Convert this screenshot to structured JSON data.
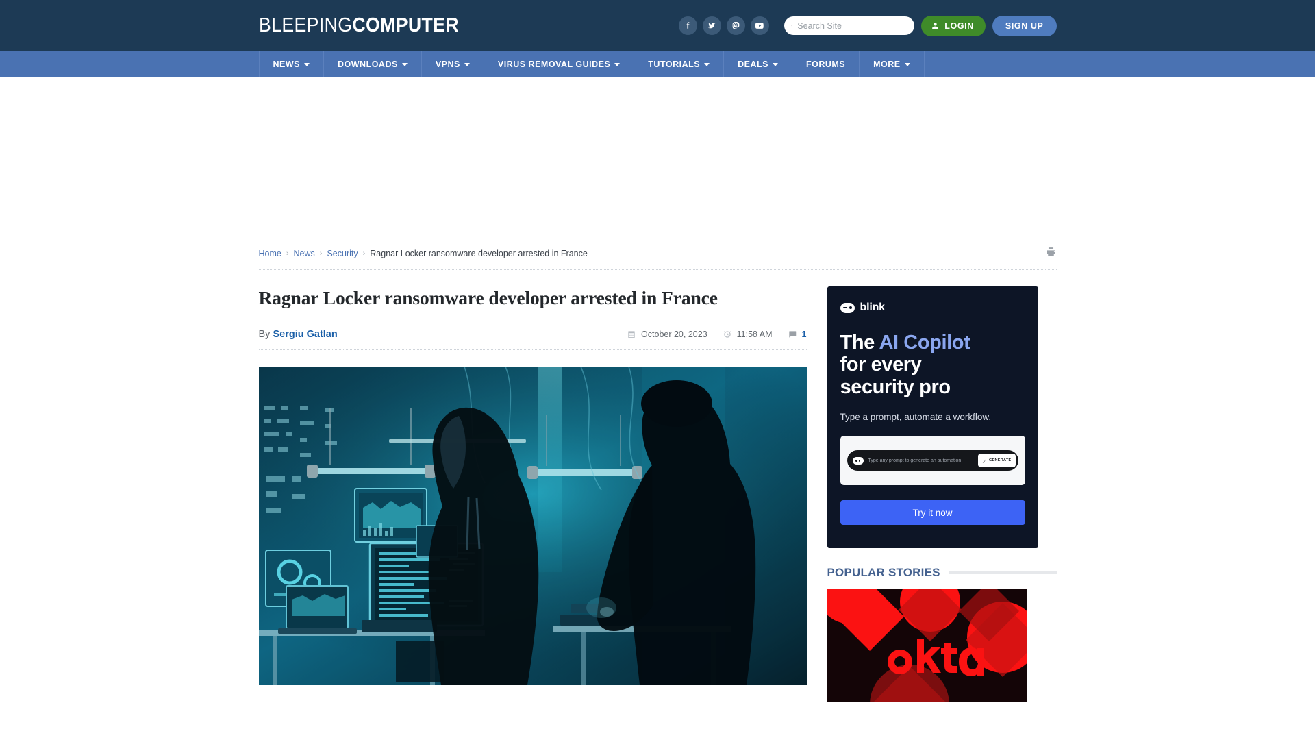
{
  "header": {
    "logo_light": "BLEEPING",
    "logo_bold": "COMPUTER",
    "socials": [
      {
        "name": "facebook-icon",
        "label": "Facebook"
      },
      {
        "name": "twitter-icon",
        "label": "Twitter"
      },
      {
        "name": "mastodon-icon",
        "label": "Mastodon"
      },
      {
        "name": "youtube-icon",
        "label": "YouTube"
      }
    ],
    "search": {
      "placeholder": "Search Site",
      "value": ""
    },
    "login_label": "LOGIN",
    "signup_label": "SIGN UP",
    "bg_color": "#1d3a55"
  },
  "nav": {
    "bg_color": "#4a72b2",
    "items": [
      {
        "label": "NEWS",
        "has_caret": true
      },
      {
        "label": "DOWNLOADS",
        "has_caret": true
      },
      {
        "label": "VPNS",
        "has_caret": true
      },
      {
        "label": "VIRUS REMOVAL GUIDES",
        "has_caret": true
      },
      {
        "label": "TUTORIALS",
        "has_caret": true
      },
      {
        "label": "DEALS",
        "has_caret": true
      },
      {
        "label": "FORUMS",
        "has_caret": false
      },
      {
        "label": "MORE",
        "has_caret": true
      }
    ]
  },
  "breadcrumb": {
    "home": "Home",
    "news": "News",
    "security": "Security",
    "current": "Ragnar Locker ransomware developer arrested in France",
    "separator": "›",
    "link_color": "#4a72b2"
  },
  "article": {
    "title": "Ragnar Locker ransomware developer arrested in France",
    "by_prefix": "By",
    "author": "Sergiu Gatlan",
    "date": "October 20, 2023",
    "time": "11:58 AM",
    "comment_count": "1",
    "hero_alt": "Hooded hacker being arrested by police officer in dark server room"
  },
  "sidebar": {
    "ad": {
      "brand": "blink",
      "headline_1": "The ",
      "headline_accent": "AI Copilot",
      "headline_2": "for every",
      "headline_3": "security pro",
      "subtitle": "Type a prompt, automate a workflow.",
      "prompt_placeholder": "Type any prompt to generate an automation",
      "generate_label": "GENERATE",
      "cta_label": "Try it now",
      "bg_color": "#0d1526",
      "cta_color": "#3d63f5",
      "accent_color": "#8aa6ef"
    },
    "popular": {
      "title": "POPULAR STORIES",
      "thumb_label": "okta"
    }
  }
}
